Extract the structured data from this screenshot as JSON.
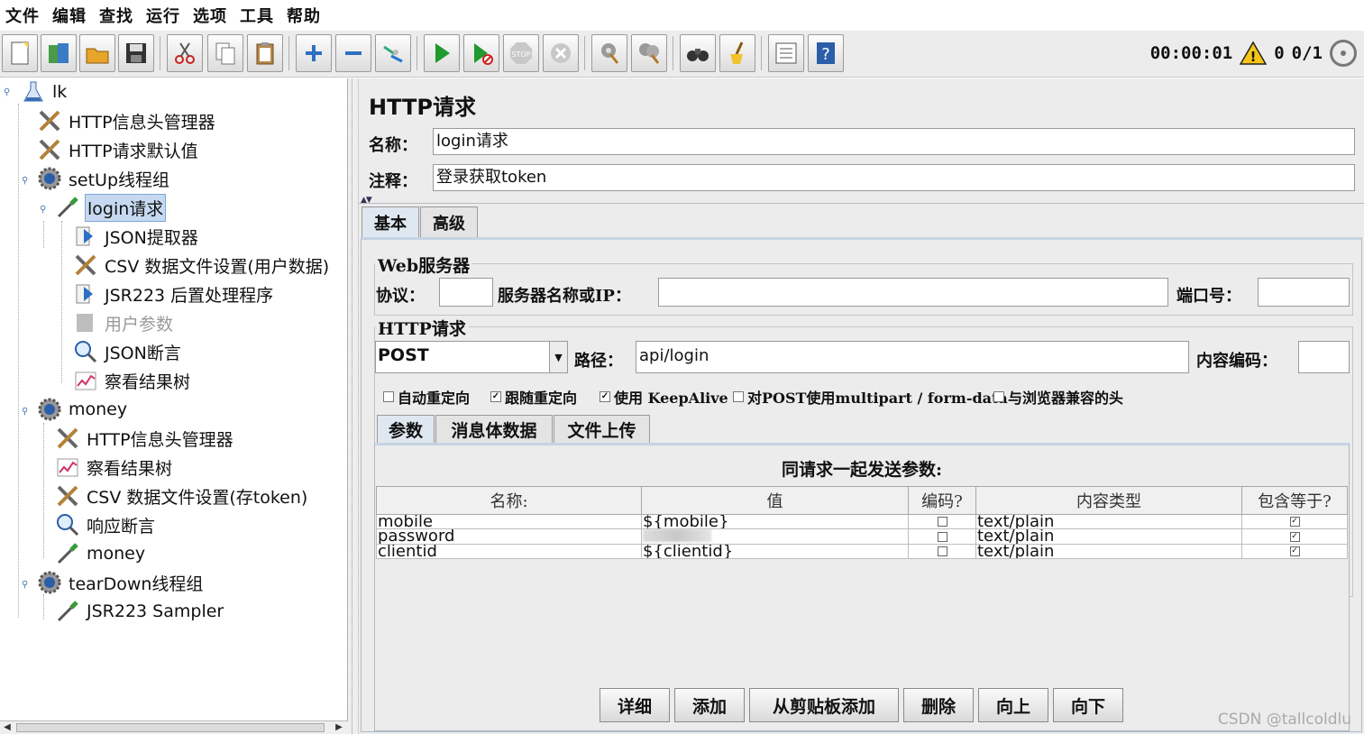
{
  "menu": [
    "文件",
    "编辑",
    "查找",
    "运行",
    "选项",
    "工具",
    "帮助"
  ],
  "toolbar_buttons": [
    {
      "name": "new-icon"
    },
    {
      "name": "templates-icon"
    },
    {
      "name": "open-icon"
    },
    {
      "name": "save-icon"
    },
    {
      "name": "cut-icon"
    },
    {
      "name": "copy-icon"
    },
    {
      "name": "paste-icon"
    },
    {
      "name": "expand-icon"
    },
    {
      "name": "collapse-icon"
    },
    {
      "name": "toggle-icon"
    },
    {
      "name": "start-icon"
    },
    {
      "name": "start-no-pause-icon"
    },
    {
      "name": "stop-icon"
    },
    {
      "name": "shutdown-icon"
    },
    {
      "name": "clear-icon"
    },
    {
      "name": "clear-all-icon"
    },
    {
      "name": "search-icon"
    },
    {
      "name": "reset-search-icon"
    },
    {
      "name": "function-helper-icon"
    },
    {
      "name": "help-icon"
    }
  ],
  "status": {
    "elapsed": "00:00:01",
    "warnings": "0",
    "threads": "0/1"
  },
  "tree": {
    "root": "lk",
    "items": [
      {
        "label": "HTTP信息头管理器"
      },
      {
        "label": "HTTP请求默认值"
      },
      {
        "label": "setUp线程组"
      },
      {
        "label": "login请求"
      },
      {
        "label": "JSON提取器"
      },
      {
        "label": "CSV 数据文件设置(用户数据)"
      },
      {
        "label": "JSR223 后置处理程序"
      },
      {
        "label": "用户参数"
      },
      {
        "label": "JSON断言"
      },
      {
        "label": "察看结果树"
      },
      {
        "label": "money"
      },
      {
        "label": "HTTP信息头管理器"
      },
      {
        "label": "察看结果树"
      },
      {
        "label": "CSV 数据文件设置(存token)"
      },
      {
        "label": "响应断言"
      },
      {
        "label": "money"
      },
      {
        "label": "tearDown线程组"
      },
      {
        "label": "JSR223 Sampler"
      }
    ]
  },
  "form": {
    "title": "HTTP请求",
    "name_label": "名称：",
    "name_value": "login请求",
    "comment_label": "注释：",
    "comment_value": "登录获取token",
    "tabs": [
      "基本",
      "高级"
    ],
    "web_server": {
      "group_title": "Web服务器",
      "protocol_label": "协议：",
      "protocol_value": "",
      "server_label": "服务器名称或IP：",
      "server_value": "",
      "port_label": "端口号：",
      "port_value": ""
    },
    "http_request": {
      "group_title": "HTTP请求",
      "method": "POST",
      "path_label": "路径：",
      "path_value": "api/login",
      "encoding_label": "内容编码：",
      "encoding_value": ""
    },
    "options": [
      {
        "label": "自动重定向",
        "checked": false
      },
      {
        "label": "跟随重定向",
        "checked": true
      },
      {
        "label": "使用 KeepAlive",
        "checked": true
      },
      {
        "label": "对POST使用multipart / form-data",
        "checked": false
      },
      {
        "label": "与浏览器兼容的头",
        "checked": false
      }
    ],
    "subtabs": [
      "参数",
      "消息体数据",
      "文件上传"
    ],
    "params_caption": "同请求一起发送参数:",
    "params_headers": [
      "名称:",
      "值",
      "编码?",
      "内容类型",
      "包含等于?"
    ],
    "params_rows": [
      {
        "name": "mobile",
        "value": "${mobile}",
        "encode": false,
        "content_type": "text/plain",
        "include_equals": true
      },
      {
        "name": "password",
        "value": "",
        "encode": false,
        "content_type": "text/plain",
        "include_equals": true
      },
      {
        "name": "clientid",
        "value": "${clientid}",
        "encode": false,
        "content_type": "text/plain",
        "include_equals": true
      }
    ],
    "buttons": [
      "详细",
      "添加",
      "从剪贴板添加",
      "删除",
      "向上",
      "向下"
    ]
  },
  "watermark": "CSDN @tallcoldlu"
}
